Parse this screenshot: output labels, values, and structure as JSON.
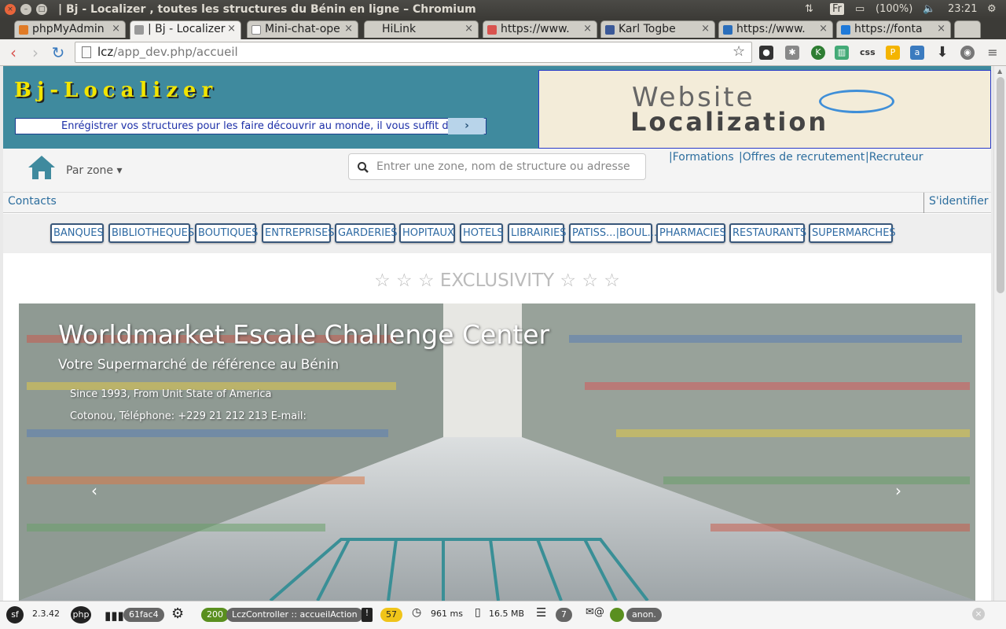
{
  "window": {
    "title": "| Bj - Localizer , toutes les structures du Bénin en ligne – Chromium",
    "tray": {
      "keyboard": "Fr",
      "battery": "(100%)",
      "clock": "23:21"
    }
  },
  "tabs": [
    {
      "label": "phpMyAdmin",
      "color": "#e07b26"
    },
    {
      "label": "| Bj - Localizer",
      "color": "#666666"
    },
    {
      "label": "Mini-chat-ope",
      "color": "#888888"
    },
    {
      "label": "HiLink",
      "color": "#cccccc"
    },
    {
      "label": "https://www.",
      "color": "#d9534f"
    },
    {
      "label": "Karl Togbe",
      "color": "#3b5998"
    },
    {
      "label": "https://www.",
      "color": "#2a6ebb"
    },
    {
      "label": "https://fonta",
      "color": "#1f7ad9"
    }
  ],
  "toolbar": {
    "url_host": "lcz",
    "url_path": "/app_dev.php/accueil"
  },
  "header": {
    "logo": "Bj-Localizer",
    "marquee": "Enrégistrer vos structures pour les faire découvrir au monde, il vous suffit de",
    "banner_line1": "Website",
    "banner_line2": "Localization"
  },
  "navbar": {
    "par_zone": "Par zone ▾",
    "search_placeholder": "Entrer une zone, nom de structure ou adresse",
    "links": [
      "|Formations",
      "|Offres de recrutement",
      "|Recruteur"
    ]
  },
  "contactbar": {
    "contacts": "Contacts",
    "signin": "S'identifier"
  },
  "categories": [
    "BANQUES",
    "BIBLIOTHEQUES",
    "BOUTIQUES",
    "ENTREPRISES",
    "GARDERIES",
    "HOPITAUX",
    "HOTELS",
    "LIBRAIRIES",
    "PATISS...|BOUL...",
    "PHARMACIES",
    "RESTAURANTS",
    "SUPERMARCHES"
  ],
  "exclusivity": {
    "title": "☆ ☆ ☆ EXCLUSIVITY ☆ ☆ ☆",
    "slide": {
      "title": "Worldmarket Escale Challenge Center",
      "subtitle": "Votre Supermarché de référence au Bénin",
      "line1": "Since 1993, From Unit State of America",
      "line2": "Cotonou, Téléphone: +229 21 212 213 E-mail:"
    }
  },
  "debugbar": {
    "symfony_version": "2.3.42",
    "token": "61fac4",
    "status": "200",
    "controller": "LczController :: accueilAction",
    "warnings": "57",
    "time": "961 ms",
    "memory": "16.5 MB",
    "queries": "7",
    "user": "anon."
  }
}
